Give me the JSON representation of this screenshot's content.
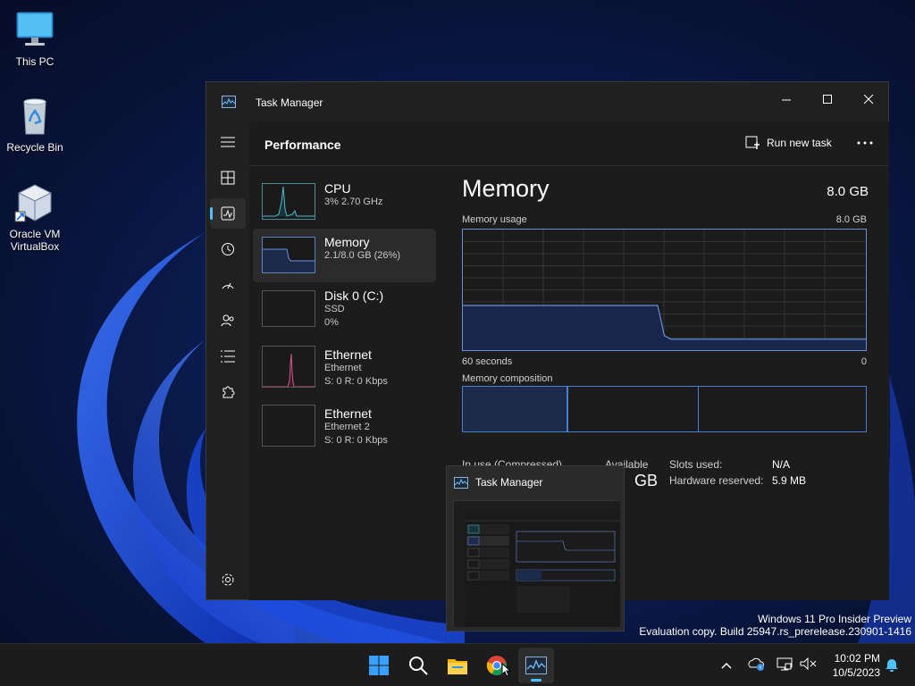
{
  "desktop": {
    "icons": [
      {
        "label": "This PC"
      },
      {
        "label": "Recycle Bin"
      },
      {
        "label": "Oracle VM VirtualBox"
      }
    ]
  },
  "window": {
    "title": "Task Manager",
    "page_title": "Performance",
    "run_new_task": "Run new task",
    "minimize": "—",
    "maximize": "☐",
    "close": "✕"
  },
  "perf_items": [
    {
      "name": "CPU",
      "sub1": "3% 2.70 GHz",
      "sub2": ""
    },
    {
      "name": "Memory",
      "sub1": "2.1/8.0 GB (26%)",
      "sub2": ""
    },
    {
      "name": "Disk 0 (C:)",
      "sub1": "SSD",
      "sub2": "0%"
    },
    {
      "name": "Ethernet",
      "sub1": "Ethernet",
      "sub2": "S: 0 R: 0 Kbps"
    },
    {
      "name": "Ethernet",
      "sub1": "Ethernet 2",
      "sub2": "S: 0 R: 0 Kbps"
    }
  ],
  "memory": {
    "title": "Memory",
    "total": "8.0 GB",
    "usage_label": "Memory usage",
    "usage_max": "8.0 GB",
    "time_left": "60 seconds",
    "time_right": "0",
    "composition_label": "Memory composition",
    "usage_fraction_series": [
      0.37,
      0.37,
      0.37,
      0.37,
      0.37,
      0.37,
      0.37,
      0.37,
      0.37,
      0.37,
      0.37,
      0.37,
      0.37,
      0.37,
      0.37,
      0.37,
      0.37,
      0.37,
      0.37,
      0.37,
      0.37,
      0.37,
      0.37,
      0.37,
      0.37,
      0.37,
      0.37,
      0.37,
      0.37,
      0.37,
      0.12,
      0.09,
      0.09,
      0.09,
      0.09,
      0.09,
      0.09,
      0.09,
      0.09,
      0.09,
      0.09,
      0.09,
      0.09,
      0.09,
      0.09,
      0.09,
      0.09,
      0.09,
      0.09,
      0.09,
      0.09,
      0.09,
      0.09,
      0.09,
      0.09,
      0.09,
      0.09,
      0.09,
      0.09,
      0.09,
      0.09
    ],
    "stats": {
      "in_use_label": "In use (Compressed)",
      "available_label": "Available",
      "available_partial": "GB",
      "slots_label": "Slots used:",
      "slots_value": "N/A",
      "hw_reserved_label": "Hardware reserved:",
      "hw_reserved_value": "5.9 MB"
    }
  },
  "preview": {
    "title": "Task Manager"
  },
  "watermark": {
    "line1": "Windows 11 Pro Insider Preview",
    "line2": "Evaluation copy. Build 25947.rs_prerelease.230901-1416"
  },
  "taskbar": {
    "time": "10:02 PM",
    "date": "10/5/2023"
  },
  "colors": {
    "accent": "#4cc2ff",
    "graph_border": "#6a8fd8",
    "cpu_line": "#4fb8c9",
    "eth_line": "#d05a8a"
  }
}
